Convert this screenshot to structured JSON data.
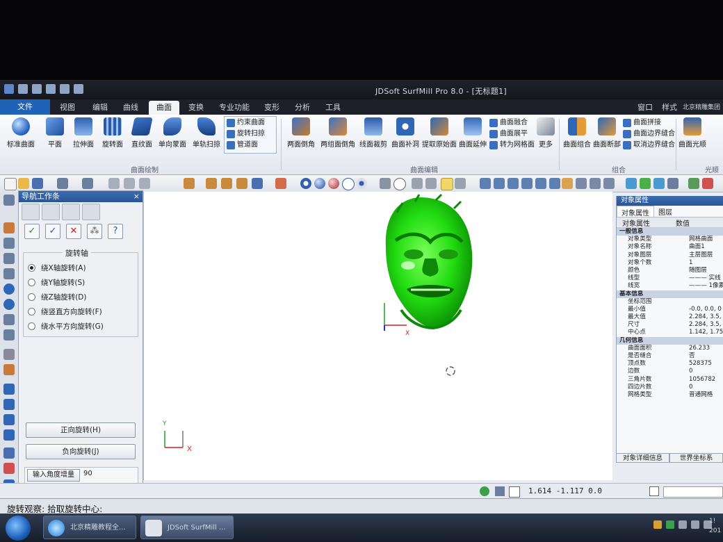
{
  "window": {
    "title": "JDSoft SurfMill Pro 8.0 - [无标题1]"
  },
  "menu_tabs": [
    "文件",
    "视图",
    "编辑",
    "曲线",
    "曲面",
    "变换",
    "专业功能",
    "变形",
    "分析",
    "工具"
  ],
  "active_tab": "曲面",
  "title_right": [
    "窗口",
    "样式",
    "北京精雕集团"
  ],
  "ribbon": {
    "large_buttons": [
      "标准曲面",
      "平面",
      "拉伸面",
      "旋转面",
      "直纹面",
      "单向蒙面",
      "单轨扫掠"
    ],
    "small_buttons": [
      "约束曲面",
      "旋转扫掠",
      "管道面"
    ],
    "group1_label": "曲面绘制",
    "edit_large": [
      "两面倒角",
      "两组面倒角",
      "线面裁剪",
      "曲面补洞",
      "提取原始面",
      "曲面延伸"
    ],
    "edit_small": [
      "曲面融合",
      "曲面展平",
      "转为网格面"
    ],
    "more_label": "更多",
    "group2_label": "曲面编辑",
    "combine_large": [
      "曲面组合",
      "曲面断部"
    ],
    "combine_small": [
      "曲面拼接",
      "曲面边界缝合",
      "取消边界缝合"
    ],
    "group3_label": "组合",
    "smooth_label": "曲面光顺",
    "group4_label": "光顺"
  },
  "nav_panel": {
    "title": "导航工作条",
    "close": "×",
    "group_title": "旋转轴",
    "options": [
      "绕X轴旋转(A)",
      "绕Y轴旋转(S)",
      "绕Z轴旋转(D)",
      "绕竖直方向旋转(F)",
      "绕水平方向旋转(G)"
    ],
    "selected_index": 0,
    "forward_btn": "正向旋转(H)",
    "reverse_btn": "负向旋转(J)",
    "angle_label": "输入角度增量",
    "angle_value": "90"
  },
  "props_panel": {
    "title": "对象属性",
    "tabs": [
      "对象属性",
      "图层"
    ],
    "col_headers": [
      "对象属性",
      "数值"
    ],
    "sections": [
      {
        "title": "一般信息",
        "rows": [
          [
            "对象类型",
            "网格曲面"
          ],
          [
            "对象名称",
            "曲面1"
          ],
          [
            "对象图层",
            "主层图层"
          ],
          [
            "对象个数",
            "1"
          ],
          [
            "颜色",
            "随图层"
          ],
          [
            "线型",
            "——— 实线"
          ],
          [
            "线宽",
            "——— 1像素"
          ]
        ]
      },
      {
        "title": "基本信息",
        "rows": [
          [
            "坐标范围",
            ""
          ],
          [
            "最小值",
            "-0.0, 0.0, 0"
          ],
          [
            "最大值",
            "2.284, 3.5,"
          ],
          [
            "尺寸",
            "2.284, 3.5,"
          ],
          [
            "中心点",
            "1.142, 1.75,"
          ]
        ]
      },
      {
        "title": "几何信息",
        "rows": [
          [
            "曲面面积",
            "26.233"
          ],
          [
            "是否缝合",
            "否"
          ],
          [
            "顶点数",
            "528375"
          ],
          [
            "边数",
            "0"
          ],
          [
            "三角片数",
            "1056782"
          ],
          [
            "四边片数",
            "0"
          ],
          [
            "网格类型",
            "普通网格"
          ]
        ]
      }
    ],
    "bottom_tabs": [
      "对象详细信息",
      "世界坐标系"
    ]
  },
  "viewport": {
    "axis_x": "X",
    "axis_y": "Y"
  },
  "status": {
    "coords": "1.614 -1.117 0.0"
  },
  "prompt": "旋转观察: 拾取旋转中心:",
  "taskbar": {
    "tasks": [
      "北京精雕教程全...",
      "JDSoft SurfMill ..."
    ],
    "clock": [
      "1!",
      "201"
    ]
  },
  "colors": {
    "model": "#22dd11",
    "accent": "#1f63b8",
    "title_bar": "#1a1d25"
  }
}
